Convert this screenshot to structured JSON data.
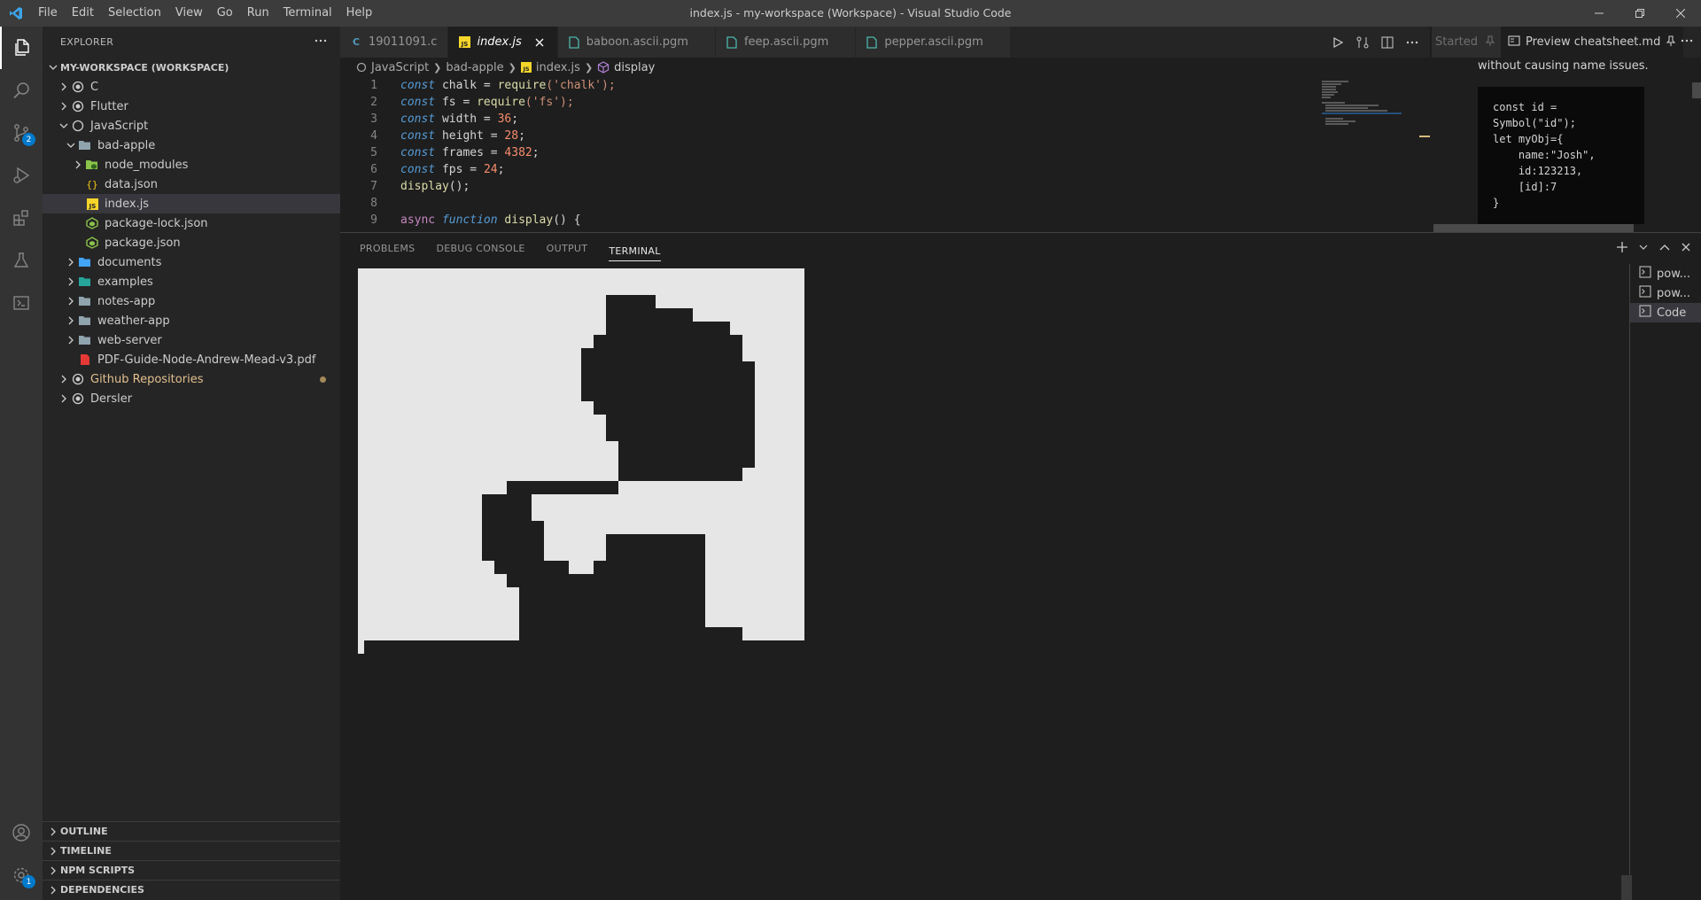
{
  "titlebar": {
    "menu": [
      "File",
      "Edit",
      "Selection",
      "View",
      "Go",
      "Run",
      "Terminal",
      "Help"
    ],
    "title": "index.js - my-workspace (Workspace) - Visual Studio Code"
  },
  "activitybar": {
    "scm_badge": "2",
    "settings_badge": "1"
  },
  "sidebar": {
    "header": "EXPLORER",
    "workspace": "MY-WORKSPACE (WORKSPACE)",
    "tree": {
      "c": "C",
      "flutter": "Flutter",
      "javascript": "JavaScript",
      "bad_apple": "bad-apple",
      "node_modules": "node_modules",
      "data_json": "data.json",
      "index_js": "index.js",
      "package_lock": "package-lock.json",
      "package_json": "package.json",
      "documents": "documents",
      "examples": "examples",
      "notes_app": "notes-app",
      "weather_app": "weather-app",
      "web_server": "web-server",
      "pdf": "PDF-Guide-Node-Andrew-Mead-v3.pdf",
      "github": "Github Repositories",
      "dersler": "Dersler"
    },
    "sections": [
      "OUTLINE",
      "TIMELINE",
      "NPM SCRIPTS",
      "DEPENDENCIES"
    ]
  },
  "tabs": {
    "t1": "19011091.c",
    "t2": "index.js",
    "t3": "baboon.ascii.pgm",
    "t4": "feep.ascii.pgm",
    "t5": "pepper.ascii.pgm",
    "c_icon": "C",
    "js_icon": "JS"
  },
  "breadcrumb": {
    "b1": "JavaScript",
    "b2": "bad-apple",
    "b3": "index.js",
    "b4": "display"
  },
  "code": {
    "lines": [
      "1",
      "2",
      "3",
      "4",
      "5",
      "6",
      "7",
      "8",
      "9"
    ],
    "const": "const",
    "chalk": "chalk",
    "fs": "fs",
    "width": "width",
    "height": "height",
    "frames": "frames",
    "fps": "fps",
    "eq": " = ",
    "require": "require",
    "chalk_str": "('chalk');",
    "fs_str": "('fs');",
    "v36": "36",
    "v28": "28",
    "v4382": "4382",
    "v24": "24",
    "semi": ";",
    "display_call": "display",
    "call_end": "();",
    "async": "async",
    "function": "function",
    "display_def": "display",
    "def_end": "() {"
  },
  "right_group": {
    "tab_started": "Started",
    "tab_preview": "Preview cheatsheet.md",
    "para": "without causing name issues.",
    "code": "const id =\nSymbol(\"id\");\nlet myObj={\n    name:\"Josh\",\n    id:123213,\n    [id]:7\n}"
  },
  "panel": {
    "tabs": [
      "PROBLEMS",
      "DEBUG CONSOLE",
      "OUTPUT",
      "TERMINAL"
    ],
    "terminals": [
      "pow...",
      "pow...",
      "Code"
    ]
  },
  "ascii_frame": {
    "cols": 36,
    "rows": 28,
    "light_color": "#e6e6e6",
    "dark_color": "#1e1e1e",
    "row_runs": [
      [
        [
          0,
          36
        ]
      ],
      [
        [
          0,
          36
        ]
      ],
      [
        [
          0,
          20
        ],
        [
          24,
          36
        ]
      ],
      [
        [
          0,
          20
        ],
        [
          27,
          36
        ]
      ],
      [
        [
          0,
          20
        ],
        [
          30,
          36
        ]
      ],
      [
        [
          0,
          19
        ],
        [
          31,
          36
        ]
      ],
      [
        [
          0,
          18
        ],
        [
          31,
          36
        ]
      ],
      [
        [
          0,
          18
        ],
        [
          32,
          36
        ]
      ],
      [
        [
          0,
          18
        ],
        [
          32,
          36
        ]
      ],
      [
        [
          0,
          18
        ],
        [
          32,
          36
        ]
      ],
      [
        [
          0,
          19
        ],
        [
          32,
          36
        ]
      ],
      [
        [
          0,
          20
        ],
        [
          32,
          36
        ]
      ],
      [
        [
          0,
          20
        ],
        [
          32,
          36
        ]
      ],
      [
        [
          0,
          21
        ],
        [
          32,
          36
        ]
      ],
      [
        [
          0,
          21
        ],
        [
          32,
          36
        ]
      ],
      [
        [
          0,
          21
        ],
        [
          31,
          36
        ]
      ],
      [
        [
          0,
          12
        ],
        [
          21,
          36
        ]
      ],
      [
        [
          0,
          10
        ],
        [
          14,
          36
        ]
      ],
      [
        [
          0,
          10
        ],
        [
          14,
          36
        ]
      ],
      [
        [
          0,
          10
        ],
        [
          15,
          36
        ]
      ],
      [
        [
          0,
          10
        ],
        [
          15,
          20
        ],
        [
          28,
          36
        ]
      ],
      [
        [
          0,
          10
        ],
        [
          15,
          20
        ],
        [
          28,
          36
        ]
      ],
      [
        [
          0,
          11
        ],
        [
          17,
          19
        ],
        [
          28,
          36
        ]
      ],
      [
        [
          0,
          12
        ],
        [
          28,
          36
        ]
      ],
      [
        [
          0,
          13
        ],
        [
          28,
          36
        ]
      ],
      [
        [
          0,
          13
        ],
        [
          28,
          36
        ]
      ],
      [
        [
          0,
          13
        ],
        [
          28,
          36
        ]
      ],
      [
        [
          0,
          13
        ],
        [
          31,
          36
        ]
      ]
    ]
  }
}
